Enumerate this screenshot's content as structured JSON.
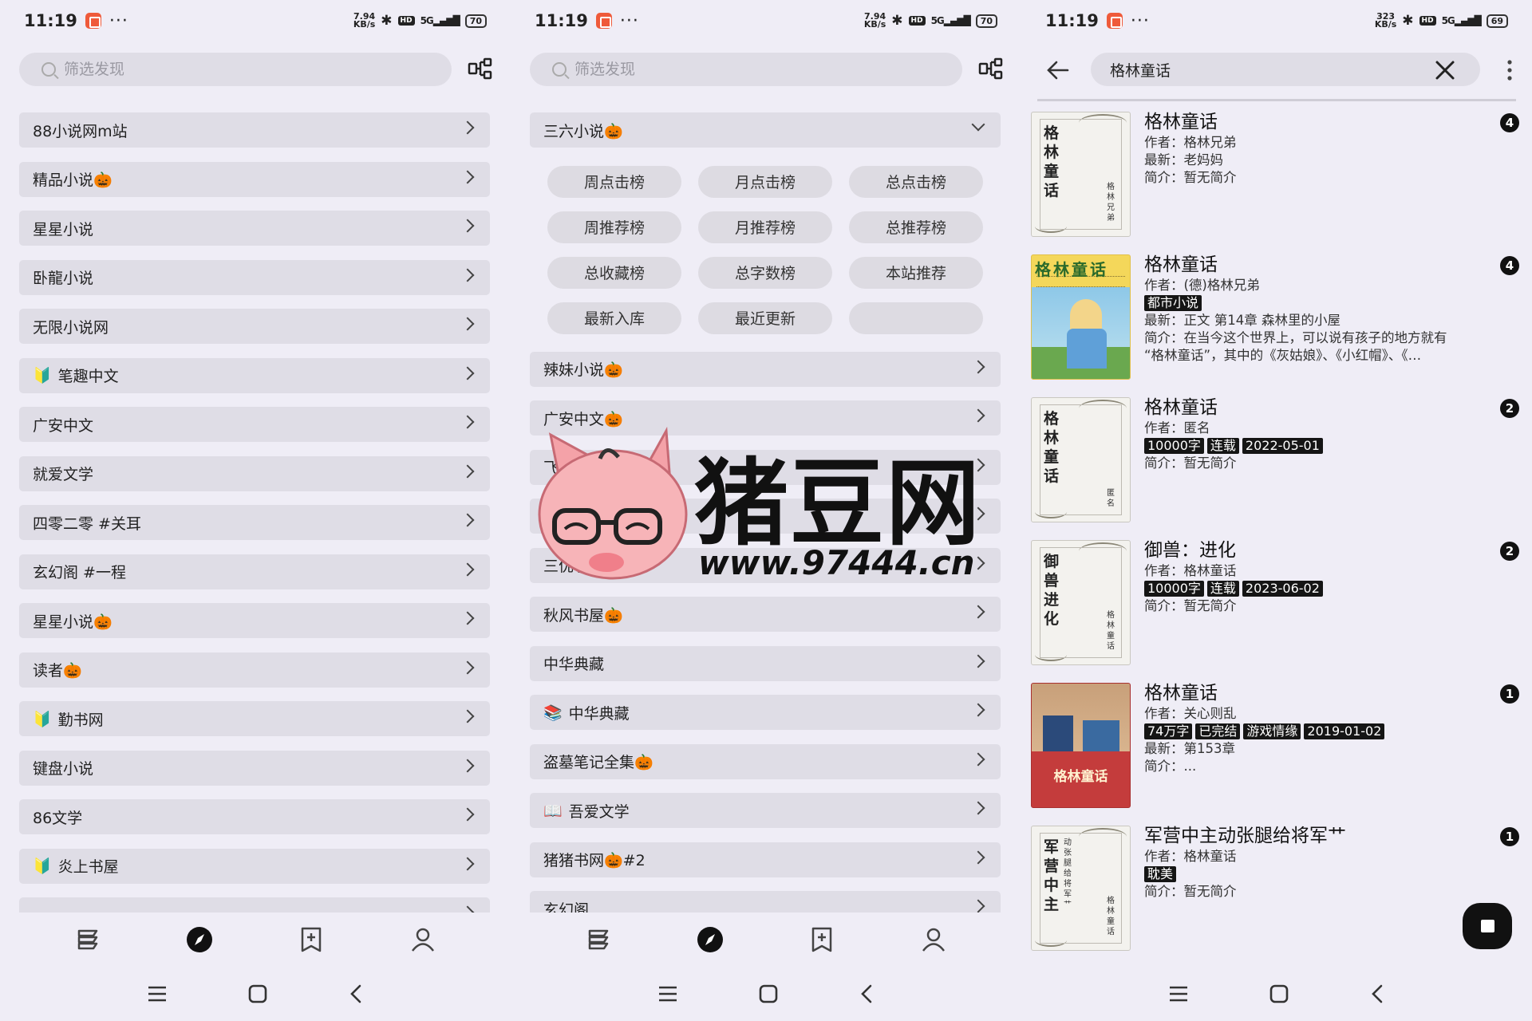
{
  "status": {
    "time": "11:19",
    "s1_speed": [
      "7.94",
      "KB/s"
    ],
    "s2_speed": [
      "7.94",
      "KB/s"
    ],
    "s3_speed": [
      "323",
      "KB/s"
    ],
    "s1_battery": "70",
    "s2_battery": "70",
    "s3_battery": "69",
    "hd": "HD",
    "signal": "5G"
  },
  "search": {
    "placeholder": "筛选发现"
  },
  "screen1": {
    "items": [
      {
        "label": "88小说网m站",
        "lead": ""
      },
      {
        "label": "精品小说🎃",
        "lead": ""
      },
      {
        "label": "星星小说",
        "lead": ""
      },
      {
        "label": "卧龍小说",
        "lead": ""
      },
      {
        "label": "无限小说网",
        "lead": ""
      },
      {
        "label": "笔趣中文",
        "lead": "🔰"
      },
      {
        "label": "广安中文",
        "lead": ""
      },
      {
        "label": "就爱文学",
        "lead": ""
      },
      {
        "label": "四零二零 #关耳",
        "lead": ""
      },
      {
        "label": "玄幻阁 #一程",
        "lead": ""
      },
      {
        "label": "星星小说🎃",
        "lead": ""
      },
      {
        "label": "读者🎃",
        "lead": ""
      },
      {
        "label": "勤书网",
        "lead": "🔰"
      },
      {
        "label": "键盘小说",
        "lead": ""
      },
      {
        "label": "86文学",
        "lead": ""
      },
      {
        "label": "炎上书屋",
        "lead": "🔰"
      },
      {
        "label": "",
        "lead": ""
      }
    ]
  },
  "screen2": {
    "expanded": "三六小说🎃",
    "chips": [
      "周点击榜",
      "月点击榜",
      "总点击榜",
      "周推荐榜",
      "月推荐榜",
      "总推荐榜",
      "总收藏榜",
      "总字数榜",
      "本站推荐",
      "最新入库",
      "最近更新",
      ""
    ],
    "items": [
      {
        "label": "辣妹小说🎃",
        "lead": ""
      },
      {
        "label": "广安中文🎃",
        "lead": ""
      },
      {
        "label": "飞卢小说🎃#2",
        "lead": ""
      },
      {
        "label": "零下书屋",
        "lead": ""
      },
      {
        "label": "三优小说🎃#2",
        "lead": ""
      },
      {
        "label": "秋风书屋🎃",
        "lead": ""
      },
      {
        "label": "中华典藏",
        "lead": ""
      },
      {
        "label": "中华典藏",
        "lead": "📚"
      },
      {
        "label": "盗墓笔记全集🎃",
        "lead": ""
      },
      {
        "label": "吾爱文学",
        "lead": "📖"
      },
      {
        "label": "猪猪书网🎃#2",
        "lead": ""
      },
      {
        "label": "玄幻阁",
        "lead": ""
      }
    ]
  },
  "watermark": {
    "title": "猪豆网",
    "url": "www.97444.cn"
  },
  "screen3": {
    "query": "格林童话",
    "results": [
      {
        "title": "格林童话",
        "badge": "4",
        "cover": "plain",
        "cover_title": "格林童话",
        "cover_author": "格林兄弟",
        "cover_sub": "",
        "lines_before": [
          "作者：格林兄弟"
        ],
        "tags": [],
        "lines_after": [
          "最新：老妈妈",
          "简介：暂无简介"
        ]
      },
      {
        "title": "格林童话",
        "badge": "4",
        "cover": "illus",
        "cover_title": "格林童话",
        "cover_author": "",
        "cover_sub": "",
        "lines_before": [
          "作者：(德)格林兄弟"
        ],
        "tags": [
          "都市小说"
        ],
        "lines_after": [
          "最新：正文 第14章 森林里的小屋",
          "简介：在当今这个世界上，可以说有孩子的地方就有",
          "“格林童话”，其中的《灰姑娘》、《小红帽》、《…"
        ]
      },
      {
        "title": "格林童话",
        "badge": "2",
        "cover": "plain",
        "cover_title": "格林童话",
        "cover_author": "匿名",
        "cover_sub": "",
        "lines_before": [
          "作者：匿名"
        ],
        "tags": [
          "10000字",
          "连载",
          "2022-05-01"
        ],
        "lines_after": [
          "简介：暂无简介"
        ]
      },
      {
        "title": "御兽：进化",
        "badge": "2",
        "cover": "plain",
        "cover_title": "御兽进化",
        "cover_author": "格林童话",
        "cover_sub": "",
        "lines_before": [
          "作者：格林童话"
        ],
        "tags": [
          "10000字",
          "连载",
          "2023-06-02"
        ],
        "lines_after": [
          "简介：暂无简介"
        ]
      },
      {
        "title": "格林童话",
        "badge": "1",
        "cover": "red",
        "cover_title": "格林童话",
        "cover_author": "",
        "cover_sub": "",
        "lines_before": [
          "作者：关心则乱"
        ],
        "tags": [
          "74万字",
          "已完结",
          "游戏情缘",
          "2019-01-02"
        ],
        "lines_after": [
          "最新：第153章",
          "简介：..."
        ]
      },
      {
        "title": "军营中主动张腿给将军艹",
        "badge": "1",
        "cover": "plain",
        "cover_title": "军营中主",
        "cover_author": "格林童话",
        "cover_sub": "动张腿给将军艹",
        "lines_before": [
          "作者：格林童话"
        ],
        "tags": [
          "耽美"
        ],
        "lines_after": [
          "简介：暂无简介"
        ]
      }
    ]
  },
  "nav": [
    "bookshelf-icon",
    "explore-icon",
    "rss-icon",
    "profile-icon"
  ],
  "colors": {
    "background": "#efedf6",
    "row": "#dfdde6",
    "tag": "#151515",
    "accent": "#111111"
  }
}
